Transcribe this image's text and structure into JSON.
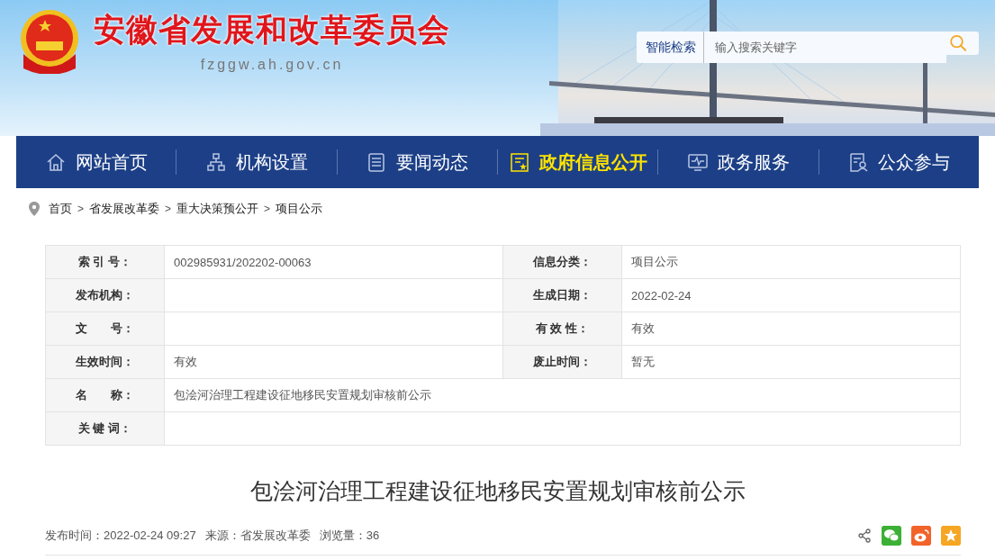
{
  "site": {
    "title": "安徽省发展和改革委员会",
    "domain": "fzggw.ah.gov.cn"
  },
  "search": {
    "label": "智能检索",
    "placeholder": "输入搜索关键字"
  },
  "nav": [
    {
      "label": "网站首页",
      "selected": false
    },
    {
      "label": "机构设置",
      "selected": false
    },
    {
      "label": "要闻动态",
      "selected": false
    },
    {
      "label": "政府信息公开",
      "selected": true
    },
    {
      "label": "政务服务",
      "selected": false
    },
    {
      "label": "公众参与",
      "selected": false
    }
  ],
  "breadcrumb": [
    {
      "kind": "link",
      "text": "首页"
    },
    {
      "kind": "sep",
      "text": ">"
    },
    {
      "kind": "link",
      "text": "省发展改革委"
    },
    {
      "kind": "sep",
      "text": ">"
    },
    {
      "kind": "link",
      "text": "重大决策预公开"
    },
    {
      "kind": "sep",
      "text": ">"
    },
    {
      "kind": "link",
      "text": "项目公示"
    }
  ],
  "info_table": {
    "rows": [
      {
        "cells": [
          {
            "label": "索 引 号：",
            "value": "002985931/202202-00063"
          },
          {
            "label": "信息分类：",
            "value": "项目公示"
          }
        ]
      },
      {
        "cells": [
          {
            "label": "发布机构："
          },
          {
            "label": "生成日期：",
            "value": "2022-02-24"
          }
        ]
      },
      {
        "cells": [
          {
            "label": "文　　号："
          },
          {
            "label": "有 效 性：",
            "value": "有效"
          }
        ]
      },
      {
        "cells": [
          {
            "label": "生效时间：",
            "value": "有效"
          },
          {
            "label": "废止时间：",
            "value": "暂无"
          }
        ]
      },
      {
        "cells": [
          {
            "label": "名　　称：",
            "value": "包浍河治理工程建设征地移民安置规划审核前公示"
          }
        ]
      },
      {
        "cells": [
          {
            "label": "关 键 词："
          }
        ]
      }
    ]
  },
  "article": {
    "title": "包浍河治理工程建设征地移民安置规划审核前公示",
    "meta": [
      "发布时间：2022-02-24 09:27",
      "来源：省发展改革委",
      "浏览量：36"
    ]
  }
}
